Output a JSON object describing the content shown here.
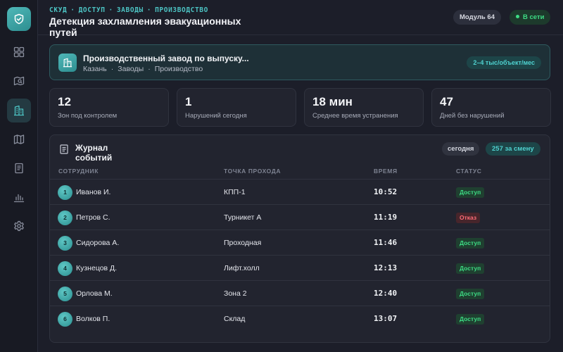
{
  "breadcrumb": [
    "СКУД",
    "ДОСТУП",
    "ЗАВОДЫ",
    "ПРОИЗВОДСТВО"
  ],
  "page_title": "Детекция захламления эвакуационных путей",
  "header_badges": {
    "module": "Модуль 64",
    "status": "В сети"
  },
  "colors": {
    "accent": "#4cc3c3",
    "ok": "#3ddc84",
    "deny": "#ff6b76",
    "background": "#1c1e29"
  },
  "sidebar": {
    "icons": [
      "grid-icon",
      "map-search-icon",
      "building-icon",
      "map-icon",
      "document-icon",
      "bar-chart-icon",
      "gear-icon"
    ],
    "active_index": 2
  },
  "facility": {
    "name": "Производственный завод по выпуску...",
    "city": "Казань",
    "type": "Заводы",
    "category": "Производство",
    "price": "2–4 тыс/объект/мес"
  },
  "stats": [
    {
      "value": "12",
      "label": "Зон под контролем"
    },
    {
      "value": "1",
      "label": "Нарушений сегодня"
    },
    {
      "value": "18 мин",
      "label": "Среднее время устранения"
    },
    {
      "value": "47",
      "label": "Дней без нарушений"
    }
  ],
  "journal": {
    "title": "Журнал событий",
    "period": "сегодня",
    "count": "257 за смену",
    "columns": [
      "СОТРУДНИК",
      "ТОЧКА ПРОХОДА",
      "ВРЕМЯ",
      "СТАТУС"
    ],
    "rows": [
      {
        "n": "1",
        "name": "Иванов И.",
        "point": "КПП-1",
        "time": "10:52",
        "status": "Доступ",
        "ok": true
      },
      {
        "n": "2",
        "name": "Петров С.",
        "point": "Турникет А",
        "time": "11:19",
        "status": "Отказ",
        "ok": false
      },
      {
        "n": "3",
        "name": "Сидорова А.",
        "point": "Проходная",
        "time": "11:46",
        "status": "Доступ",
        "ok": true
      },
      {
        "n": "4",
        "name": "Кузнецов Д.",
        "point": "Лифт.холл",
        "time": "12:13",
        "status": "Доступ",
        "ok": true
      },
      {
        "n": "5",
        "name": "Орлова М.",
        "point": "Зона 2",
        "time": "12:40",
        "status": "Доступ",
        "ok": true
      },
      {
        "n": "6",
        "name": "Волков П.",
        "point": "Склад",
        "time": "13:07",
        "status": "Доступ",
        "ok": true
      }
    ]
  }
}
